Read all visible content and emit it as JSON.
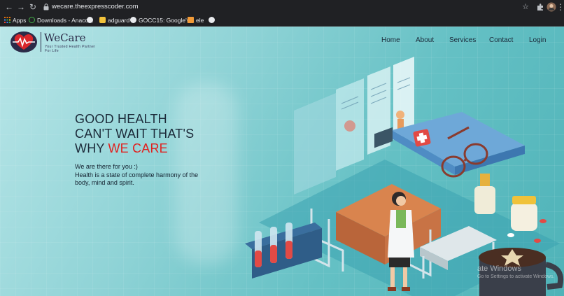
{
  "browser": {
    "url": "wecare.theexpresscoder.com",
    "bookmarks": [
      {
        "label": "Apps",
        "icon": "apps-grid-icon"
      },
      {
        "label": "Downloads - Anaco...",
        "icon": "anaconda-icon"
      },
      {
        "label": "",
        "icon": "globe-icon"
      },
      {
        "label": "adguard",
        "icon": "bookmark-folder-icon"
      },
      {
        "label": "GOCC15: Google's...",
        "icon": "google-icon"
      },
      {
        "label": "ele",
        "icon": "bookmark-image-icon"
      },
      {
        "label": "",
        "icon": "globe-icon"
      }
    ]
  },
  "header": {
    "brand": "WeCare",
    "tagline": "Your Trusted Health Partner For Life",
    "nav": [
      "Home",
      "About",
      "Services",
      "Contact",
      "Login"
    ]
  },
  "hero": {
    "title_line1": "GOOD HEALTH",
    "title_line2": "CAN'T WAIT THAT'S",
    "title_line3_prefix": "WHY ",
    "title_line3_accent": "WE CARE",
    "body_line1": "We are there for you :)",
    "body_line2": "Health is a state of complete harmony of the body, mind and spirit."
  },
  "watermark": {
    "title": "ate Windows",
    "subtitle": "Go to Settings to activate Windows."
  },
  "colors": {
    "accent": "#e0211f",
    "text_dark": "#1c2b3a",
    "page_teal": "#64c0c4",
    "chrome_bg": "#202124"
  }
}
